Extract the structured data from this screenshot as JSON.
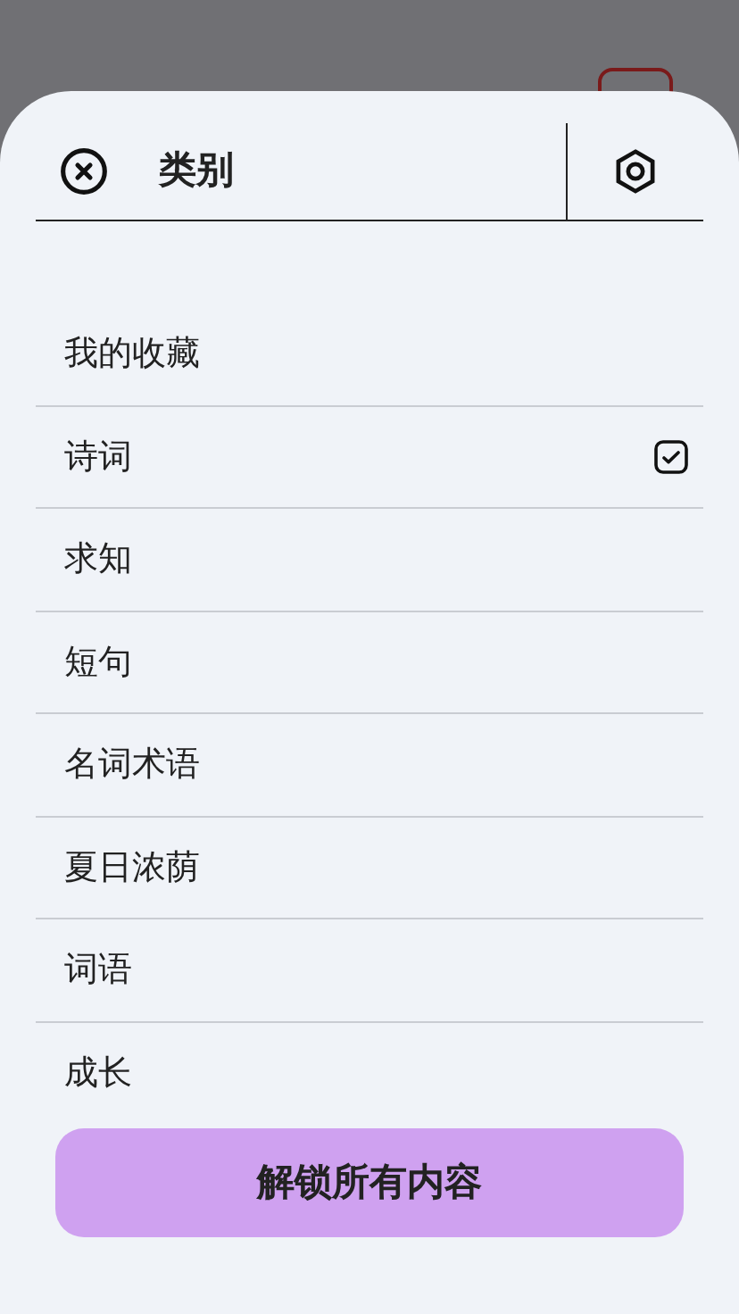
{
  "sheet": {
    "title": "类别"
  },
  "categories": [
    {
      "label": "我的收藏",
      "selected": false
    },
    {
      "label": "诗词",
      "selected": true
    },
    {
      "label": "求知",
      "selected": false
    },
    {
      "label": "短句",
      "selected": false
    },
    {
      "label": "名词术语",
      "selected": false
    },
    {
      "label": "夏日浓荫",
      "selected": false
    },
    {
      "label": "词语",
      "selected": false
    },
    {
      "label": "成长",
      "selected": false
    }
  ],
  "unlock_button": {
    "label": "解锁所有内容"
  }
}
